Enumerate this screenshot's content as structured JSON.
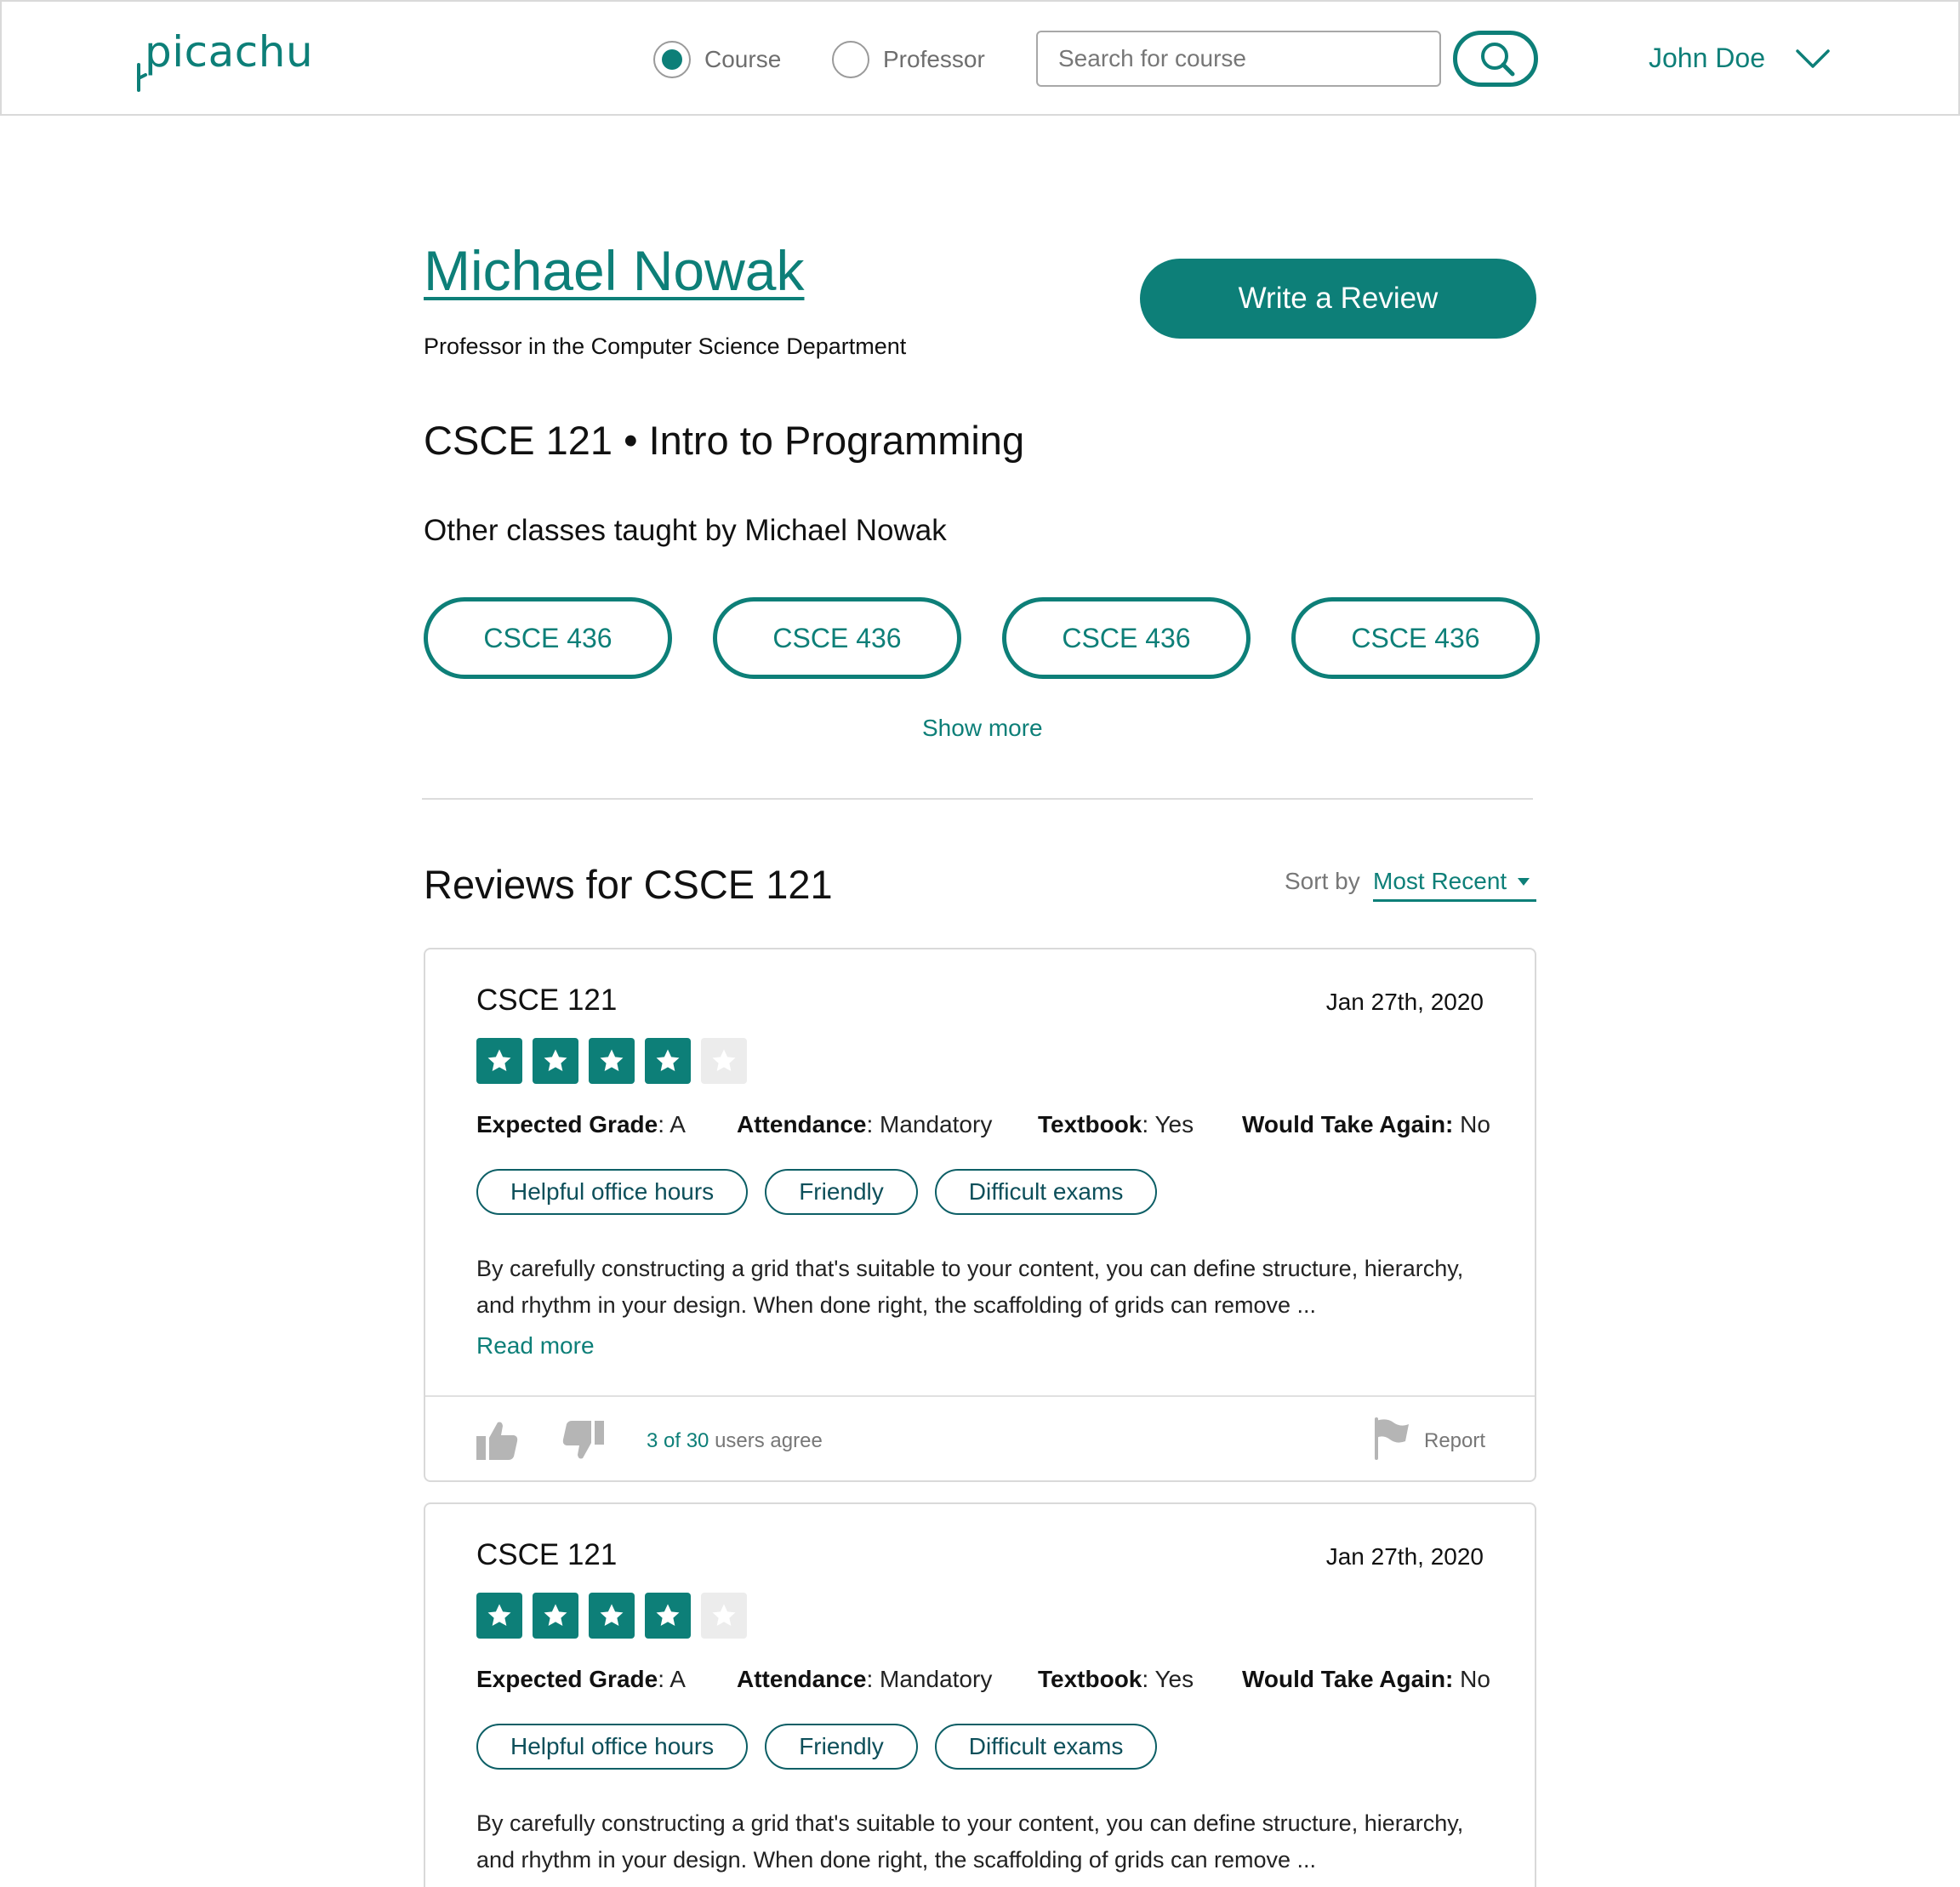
{
  "nav": {
    "logo_text": "picachu",
    "radio_course_label": "Course",
    "radio_professor_label": "Professor",
    "selected_radio": "Course",
    "search_placeholder": "Search for course",
    "user_name": "John Doe",
    "accent_color": "#0d7f78"
  },
  "professor": {
    "name": "Michael Nowak",
    "department": "Professor in the Computer Science Department",
    "write_review_label": "Write a Review"
  },
  "course": {
    "title": "CSCE 121 • Intro to Programming"
  },
  "other_classes": {
    "heading": "Other classes taught by Michael Nowak",
    "items": [
      "CSCE 436",
      "CSCE 436",
      "CSCE 436",
      "CSCE 436"
    ],
    "show_more_label": "Show more"
  },
  "reviews": {
    "heading": "Reviews for CSCE 121",
    "sort_label": "Sort by",
    "sort_value": "Most Recent",
    "items": [
      {
        "course": "CSCE 121",
        "date": "Jan 27th, 2020",
        "rating": 4,
        "rating_max": 5,
        "grade_label": "Expected Grade",
        "grade_value": ": A",
        "attendance_label": "Attendance",
        "attendance_value": ": Mandatory",
        "textbook_label": "Textbook",
        "textbook_value": ": Yes",
        "again_label": "Would Take Again:",
        "again_value": " No",
        "tags": [
          "Helpful office hours",
          "Friendly",
          "Difficult exams"
        ],
        "text": "By carefully constructing a grid that's suitable to your content, you can define structure, hierarchy, and rhythm in your design. When done right, the scaffolding of grids can remove ...",
        "read_more_label": "Read more",
        "agree_count": "3 of 30",
        "agree_suffix": " users agree",
        "report_label": "Report"
      },
      {
        "course": "CSCE 121",
        "date": "Jan 27th, 2020",
        "rating": 4,
        "rating_max": 5,
        "grade_label": "Expected Grade",
        "grade_value": ": A",
        "attendance_label": "Attendance",
        "attendance_value": ": Mandatory",
        "textbook_label": "Textbook",
        "textbook_value": ": Yes",
        "again_label": "Would Take Again:",
        "again_value": " No",
        "tags": [
          "Helpful office hours",
          "Friendly",
          "Difficult exams"
        ],
        "text": "By carefully constructing a grid that's suitable to your content, you can define structure, hierarchy, and rhythm in your design. When done right, the scaffolding of grids can remove ..."
      }
    ]
  }
}
